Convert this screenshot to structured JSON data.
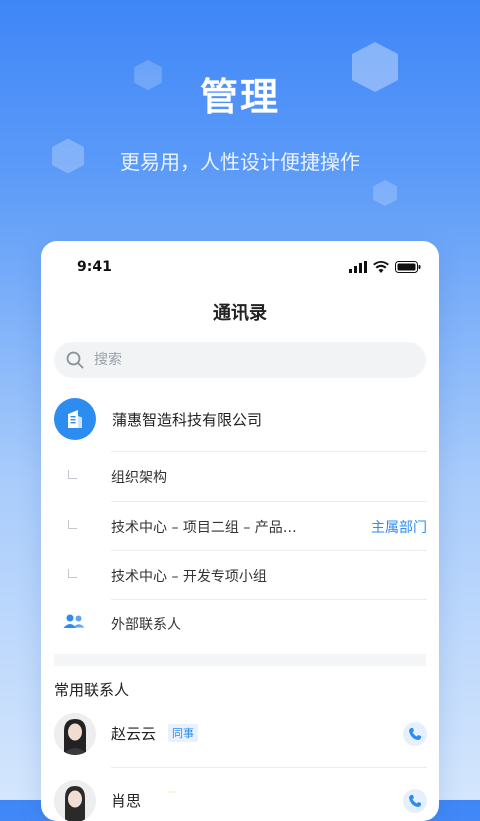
{
  "promo": {
    "title": "管理",
    "subtitle": "更易用，人性设计便捷操作"
  },
  "status_bar": {
    "time": "9:41"
  },
  "nav": {
    "title": "通讯录"
  },
  "search": {
    "placeholder": "搜索"
  },
  "company": {
    "name": "蒲惠智造科技有限公司",
    "icon": "building-icon"
  },
  "departments": [
    {
      "label": "组织架构",
      "tag": ""
    },
    {
      "label": "技术中心 – 项目二组 – 产品…",
      "tag": "主属部门"
    },
    {
      "label": "技术中心 – 开发专项小组",
      "tag": ""
    }
  ],
  "external": {
    "label": "外部联系人",
    "icon": "people-icon"
  },
  "frequent": {
    "title": "常用联系人",
    "contacts": [
      {
        "name": "赵云云",
        "badge": "同事"
      },
      {
        "name": "肖思",
        "badge": ""
      }
    ]
  },
  "colors": {
    "accent": "#2d8cf0",
    "bg_top": "#3f86f7",
    "bg_bottom": "#d4e6fd"
  }
}
